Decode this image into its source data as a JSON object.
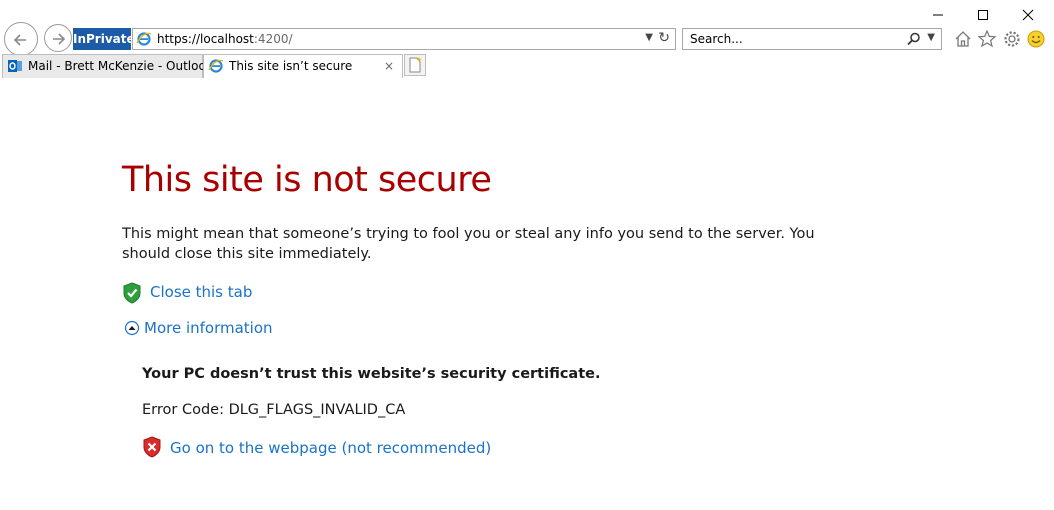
{
  "window": {
    "minimize_label": "",
    "maximize_label": "",
    "close_label": ""
  },
  "nav": {
    "inprivate_label": "InPrivate"
  },
  "address": {
    "scheme": "https://",
    "host": "localhost",
    "rest": ":4200/"
  },
  "search": {
    "value": "Search..."
  },
  "tabs": [
    {
      "label": "Mail - Brett McKenzie - Outlook",
      "icon": "outlook-icon"
    },
    {
      "label": "This site isn’t secure",
      "icon": "ie-icon",
      "close": "×"
    }
  ],
  "page": {
    "title": "This site is not secure",
    "description": "This might mean that someone’s trying to fool you or steal any info you send to the server. You should close this site immediately.",
    "close_tab_link": "Close this tab",
    "more_info_link": "More information",
    "cert_message": "Your PC doesn’t trust this website’s security certificate.",
    "error_code": "Error Code: DLG_FLAGS_INVALID_CA",
    "go_on_link": "Go on to the webpage (not recommended)"
  },
  "colors": {
    "title_red": "#a80000",
    "link_blue": "#1a73c9",
    "inprivate_blue": "#1c5ba8"
  }
}
